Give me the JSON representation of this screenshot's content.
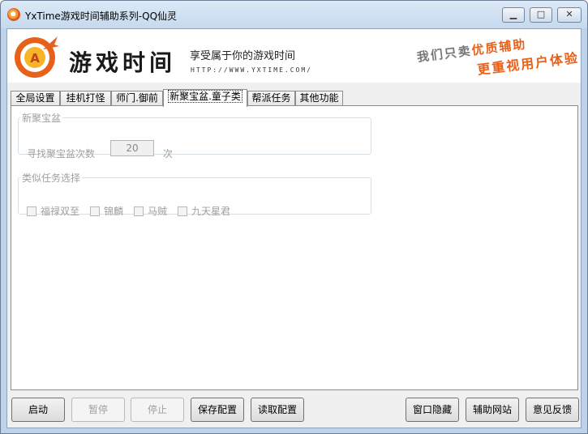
{
  "window": {
    "title": "YxTime游戏时间辅助系列-QQ仙灵",
    "min_glyph": "▁",
    "max_glyph": "□",
    "close_glyph": "✕"
  },
  "banner": {
    "logo_letter": "A",
    "logo_text": "游戏时间",
    "slogan": "享受属于你的游戏时间",
    "url": "HTTP://WWW.YXTIME.COM/",
    "right_line1_prefix": "我们只卖",
    "right_line1_highlight": "优质辅助",
    "right_line2": "更重视用户体验"
  },
  "tabs": [
    {
      "label": "全局设置"
    },
    {
      "label": "挂机打怪"
    },
    {
      "label": "师门.御前"
    },
    {
      "label": "新聚宝盆.童子类"
    },
    {
      "label": "帮派任务"
    },
    {
      "label": "其他功能"
    }
  ],
  "active_tab_index": 3,
  "panel": {
    "group1": {
      "legend": "新聚宝盆",
      "count_label": "寻找聚宝盆次数",
      "count_value": "20",
      "count_unit": "次"
    },
    "group2": {
      "legend": "类似任务选择",
      "options": [
        {
          "label": "福禄双至",
          "checked": false
        },
        {
          "label": "锦麟",
          "checked": false
        },
        {
          "label": "马贼",
          "checked": false
        },
        {
          "label": "九天星君",
          "checked": false
        }
      ]
    }
  },
  "buttons": {
    "start": "启动",
    "pause": "暂停",
    "stop": "停止",
    "save_config": "保存配置",
    "load_config": "读取配置",
    "hide_window": "窗口隐藏",
    "website": "辅助网站",
    "feedback": "意见反馈"
  },
  "colors": {
    "accent_orange": "#e8611a",
    "titlebar": "#c6d9ee"
  }
}
